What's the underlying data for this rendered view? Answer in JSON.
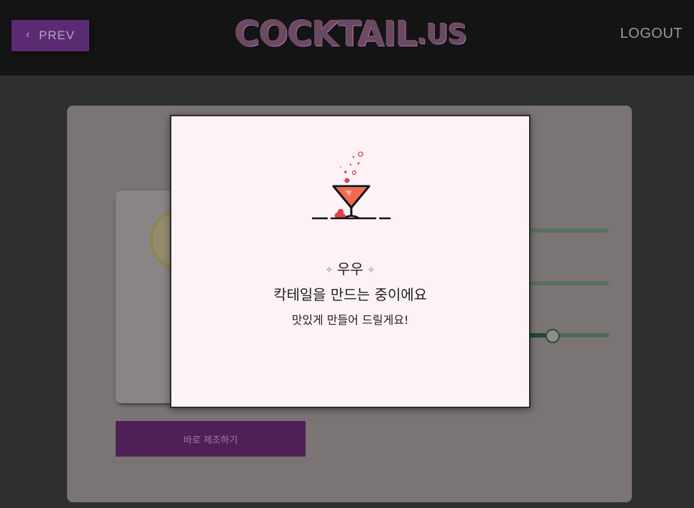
{
  "header": {
    "prev_label": "PREV",
    "logo_main": "COCKTAIL",
    "logo_tail": ".US",
    "logout_label": "LOGOUT"
  },
  "page": {
    "make_now_label": "바로 제조하기"
  },
  "modal": {
    "spark_left": "✧",
    "spark_right": "✧",
    "exclaim": "우우",
    "line1": "칵테일을 만드는 중이에요",
    "line2": "맛있게 만들어 드릴게요!"
  },
  "icons": {
    "prev": "chevron-left-icon",
    "cocktail": "cocktail-glass-icon"
  },
  "colors": {
    "accent": "#5a2a72",
    "modal_bg": "#fdf3f6",
    "slider": "#57725f",
    "drink": "#f26a4b"
  }
}
